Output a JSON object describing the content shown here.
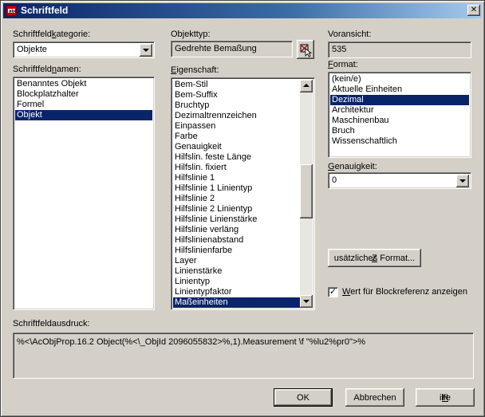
{
  "window": {
    "title": "Schriftfeld"
  },
  "category": {
    "label_pre": "Schriftfeld",
    "label_ul": "k",
    "label_post": "ategorie:",
    "value": "Objekte"
  },
  "names": {
    "label_pre": "Schriftfeld",
    "label_ul": "n",
    "label_post": "amen:",
    "items": [
      "Benanntes Objekt",
      "Blockplatzhalter",
      "Formel",
      "Objekt"
    ],
    "selected_index": 3
  },
  "object_type": {
    "label": "Objekttyp:",
    "value": "Gedrehte Bemaßung",
    "pick_icon": "select-object-icon"
  },
  "property": {
    "label_pre": "",
    "label_ul": "E",
    "label_post": "igenschaft:",
    "items": [
      "Bem-Stil",
      "Bem-Suffix",
      "Bruchtyp",
      "Dezimaltrennzeichen",
      "Einpassen",
      "Farbe",
      "Genauigkeit",
      "Hilfslin. feste Länge",
      "Hilfslin. fixiert",
      "Hilfslinie 1",
      "Hilfslinie 1 Linientyp",
      "Hilfslinie 2",
      "Hilfslinie 2 Linientyp",
      "Hilfslinie Linienstärke",
      "Hilfslinie verläng",
      "Hilfslinienabstand",
      "Hilfslinienfarbe",
      "Layer",
      "Linienstärke",
      "Linientyp",
      "Linientypfaktor",
      "Maßeinheiten"
    ],
    "selected_index": 21
  },
  "preview": {
    "label": "Voransicht:",
    "value": "535"
  },
  "format": {
    "label_pre": "",
    "label_ul": "F",
    "label_post": "ormat:",
    "items": [
      "(kein/e)",
      "Aktuelle Einheiten",
      "Dezimal",
      "Architektur",
      "Maschinenbau",
      "Bruch",
      "Wissenschaftlich"
    ],
    "selected_index": 2
  },
  "precision": {
    "label_pre": "",
    "label_ul": "G",
    "label_post": "enauigkeit:",
    "value": "0"
  },
  "additional_format_button": {
    "label_pre": "",
    "label_ul": "Z",
    "label_post": "usätzliches Format..."
  },
  "block_checkbox": {
    "checked": true,
    "label_pre": "",
    "label_ul": "W",
    "label_post": "ert für Blockreferenz anzeigen"
  },
  "expression": {
    "label": "Schriftfeldausdruck:",
    "value": "%<\\AcObjProp.16.2 Object(%<\\_ObjId 2096055832>%,1).Measurement \\f \"%lu2%pr0\">%"
  },
  "buttons": {
    "ok": "OK",
    "cancel": "Abbrechen",
    "help_ul": "H",
    "help_post": "ilfe"
  }
}
